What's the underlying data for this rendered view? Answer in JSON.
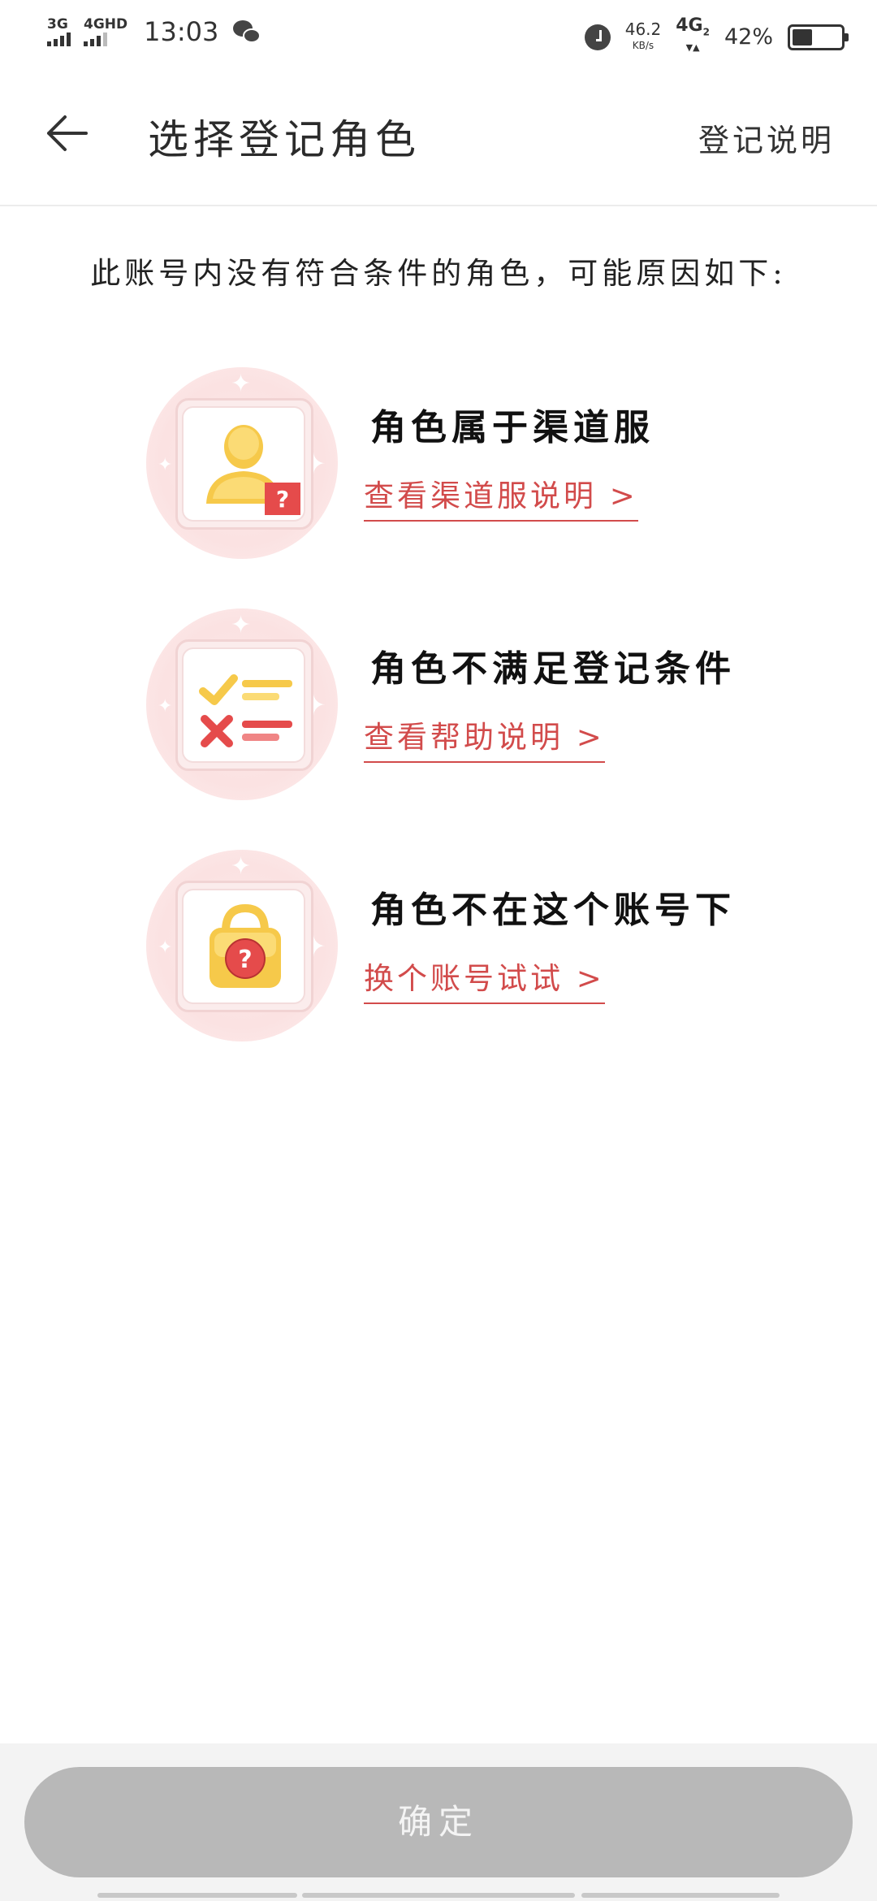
{
  "status_bar": {
    "net1": "3G",
    "net2": "4GHD",
    "time": "13:03",
    "speed_value": "46.2",
    "speed_unit": "KB/s",
    "net3": "4G",
    "net3_sub": "2",
    "battery_percent": "42%",
    "battery_level": 0.42,
    "icons": [
      "wechat-icon",
      "alarm-icon",
      "battery-icon"
    ]
  },
  "header": {
    "title": "选择登记角色",
    "help_label": "登记说明"
  },
  "intro_text": "此账号内没有符合条件的角色，可能原因如下:",
  "reasons": [
    {
      "title": "角色属于渠道服",
      "link": "查看渠道服说明 >",
      "icon": "user-question-icon"
    },
    {
      "title": "角色不满足登记条件",
      "link": "查看帮助说明 >",
      "icon": "checklist-icon"
    },
    {
      "title": "角色不在这个账号下",
      "link": "换个账号试试 >",
      "icon": "lock-question-icon"
    }
  ],
  "footer": {
    "confirm_label": "确定"
  },
  "colors": {
    "accent_red": "#d24b4b",
    "button_disabled": "#b8b8b8",
    "illustration_bg": "#fbe2e2"
  }
}
